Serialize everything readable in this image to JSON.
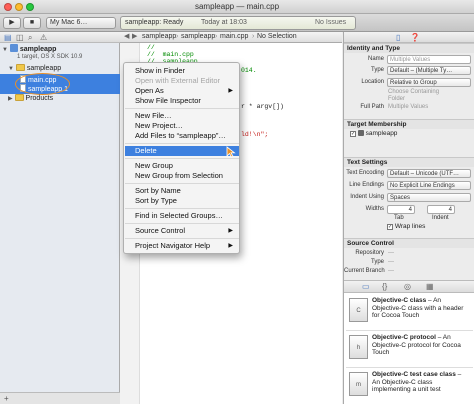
{
  "window": {
    "title": "sampleapp — main.cpp"
  },
  "toolbar": {
    "scheme": "My Mac 6…",
    "status_left": "sampleapp: Ready",
    "status_mid": "Today at 18:03",
    "status_right": "No Issues"
  },
  "navigator": {
    "project": "sampleapp",
    "project_sub": "1 target, OS X SDK 10.9",
    "group": "sampleapp",
    "file1": "main.cpp",
    "file2": "sampleapp.1",
    "products": "Products"
  },
  "jumpbar": {
    "crumb1": "sampleapp",
    "crumb2": "sampleapp",
    "crumb3": "main.cpp",
    "crumb4": "No Selection"
  },
  "code": {
    "line1": "//",
    "line2": "//  main.cpp",
    "line3": "//  sampleapp",
    "line4": "//",
    "frag1": "014.",
    "frag2": "r * argv[])",
    "frag3": "ld!\\n\";"
  },
  "context_menu": {
    "items": [
      "Show in Finder",
      "Open with External Editor",
      "Open As",
      "Show File Inspector",
      "New File…",
      "New Project…",
      "Add Files to “sampleapp”…",
      "Delete",
      "New Group",
      "New Group from Selection",
      "Sort by Name",
      "Sort by Type",
      "Find in Selected Groups…",
      "Source Control",
      "Project Navigator Help"
    ]
  },
  "inspector": {
    "identity_header": "Identity and Type",
    "name_label": "Name",
    "name_placeholder": "Multiple Values",
    "type_label": "Type",
    "type_value": "Default – (Multiple Ty…",
    "location_label": "Location",
    "location_value": "Relative to Group",
    "location_hint1": "Choose Containing",
    "location_hint2": "Folder",
    "fullpath_label": "Full Path",
    "fullpath_value": "Multiple Values",
    "target_header": "Target Membership",
    "target_name": "sampleapp",
    "text_header": "Text Settings",
    "encoding_label": "Text Encoding",
    "encoding_value": "Default – Unicode (UTF…",
    "endings_label": "Line Endings",
    "endings_value": "No Explicit Line Endings",
    "indent_label": "Indent Using",
    "indent_value": "Spaces",
    "widths_label": "Widths",
    "tab_width": "4",
    "indent_width": "4",
    "tab_caption": "Tab",
    "indent_caption": "Indent",
    "wrap_label": "Wrap lines",
    "sc_header": "Source Control",
    "repo_label": "Repository",
    "sctype_label": "Type",
    "current_branch_label": "Current Branch",
    "repo_value": "—",
    "sctype_value": "—",
    "current_branch_value": "—"
  },
  "library": {
    "items": [
      {
        "icon": "C",
        "title": "Objective-C class",
        "desc": " – An Objective-C class with a header for Cocoa Touch"
      },
      {
        "icon": "h",
        "title": "Objective-C protocol",
        "desc": " – An Objective-C protocol for Cocoa Touch"
      },
      {
        "icon": "m",
        "title": "Objective-C test case class",
        "desc": " – An Objective-C class implementing a unit test"
      }
    ]
  },
  "colors": {
    "selection": "#3d80df",
    "navigator_bg": "#e6eaf0",
    "highlight_ring": "#e8902a",
    "comment_green": "#008a00"
  }
}
